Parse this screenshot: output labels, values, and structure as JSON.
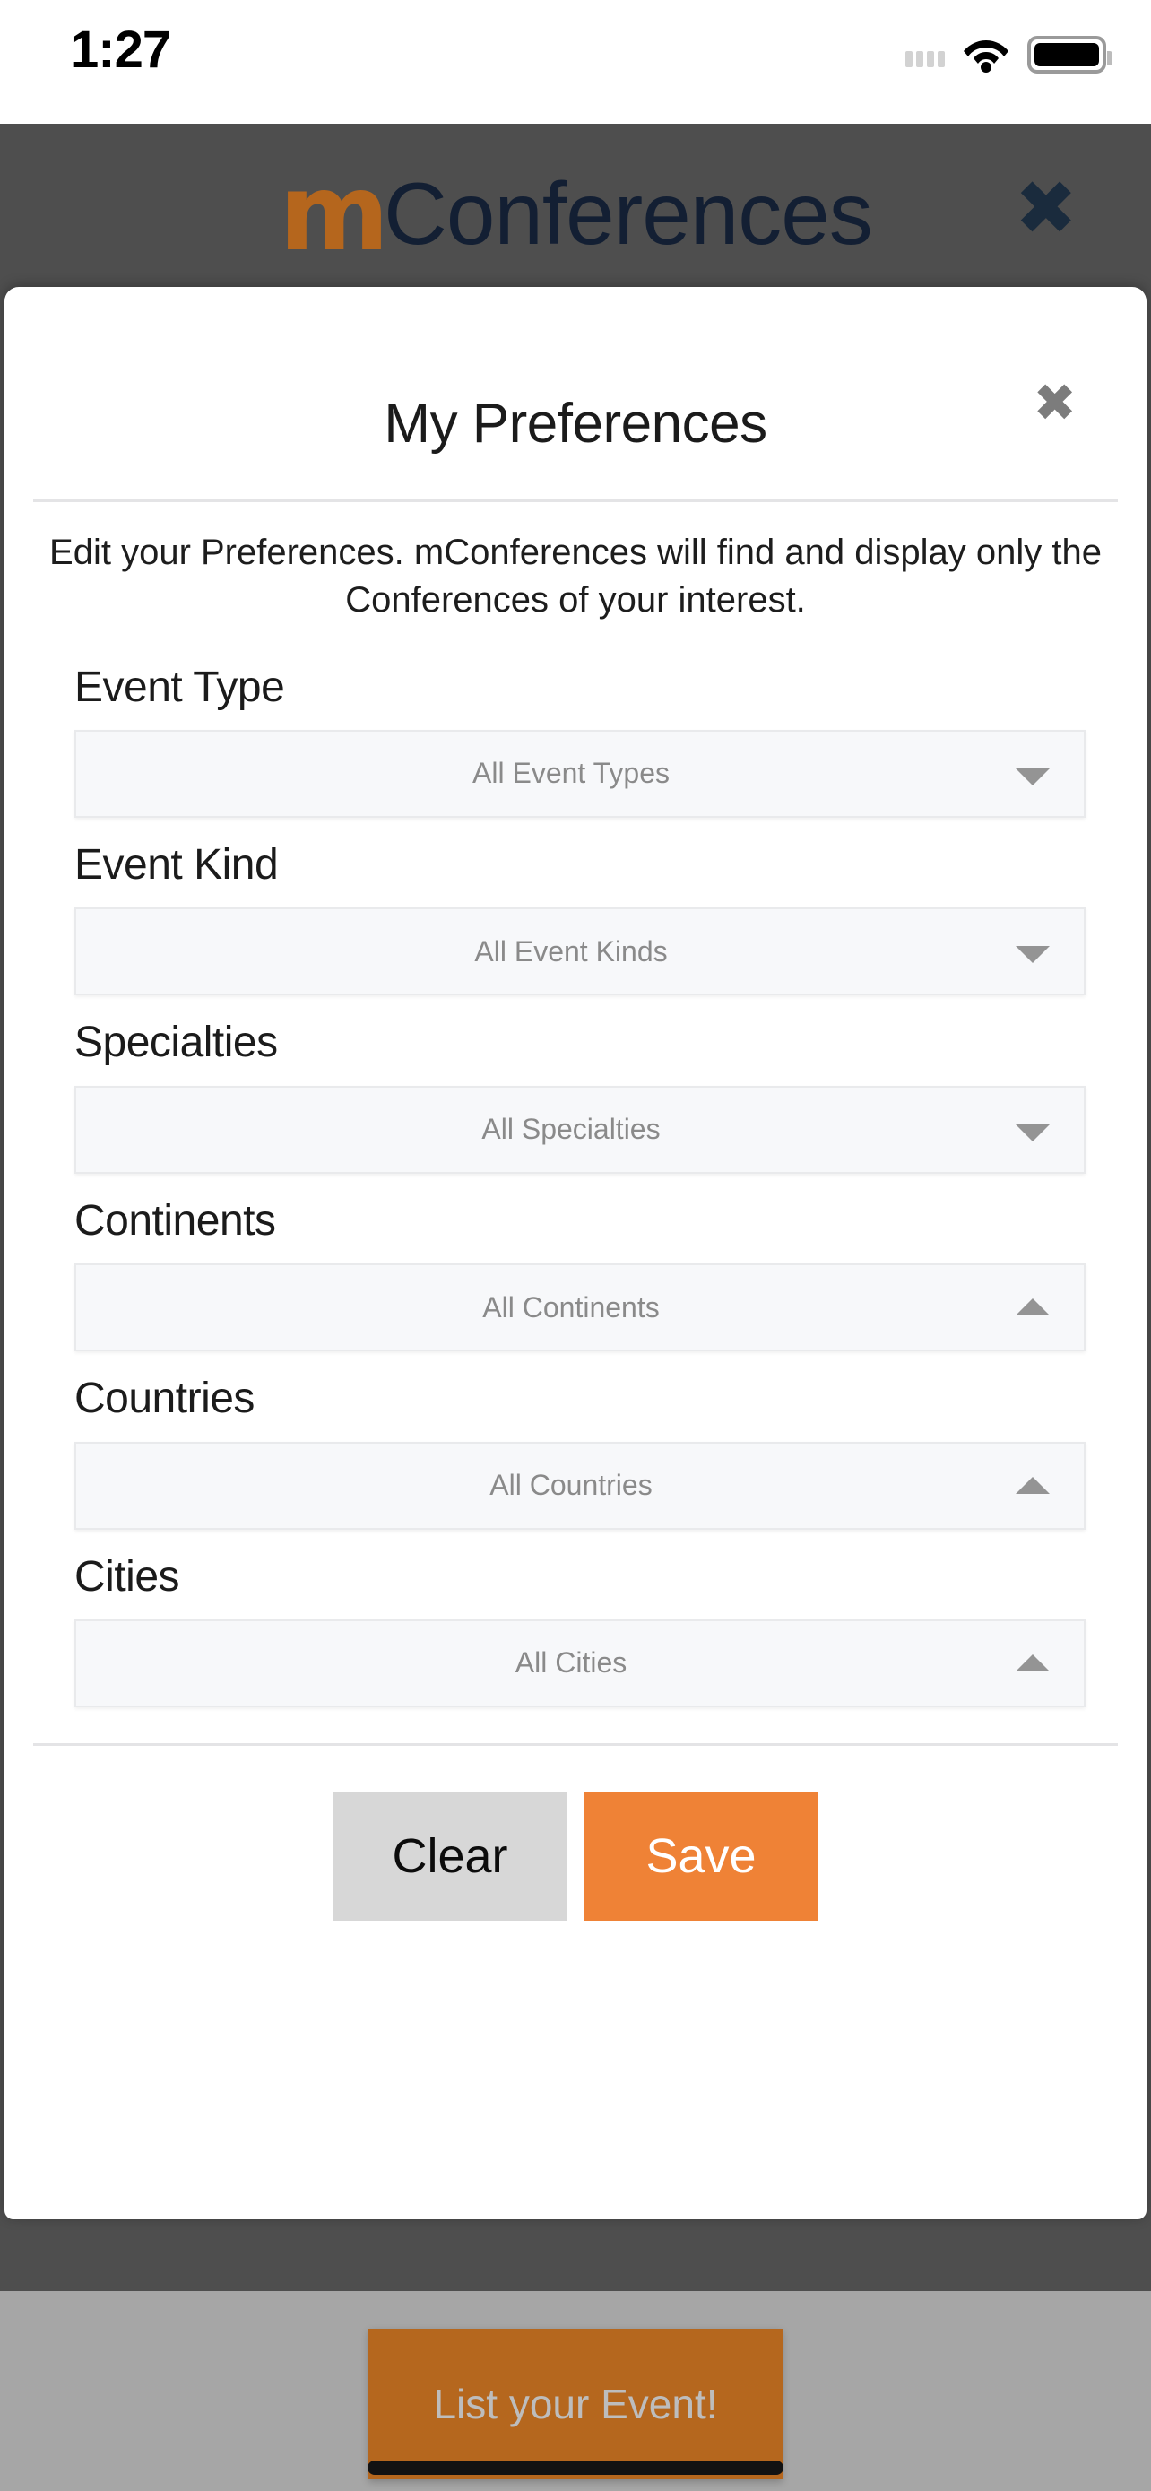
{
  "status_bar": {
    "time": "1:27",
    "signal_icon": "signal-dots-icon",
    "wifi_icon": "wifi-icon",
    "battery_icon": "battery-full-icon"
  },
  "app_header": {
    "brand_prefix": "m",
    "brand_name": "Conferences",
    "close_label": "✖",
    "brand_accent_color": "#b5661d",
    "brand_text_color": "#131f33",
    "background_color": "#4e4e4e"
  },
  "modal": {
    "title": "My Preferences",
    "close_label": "✖",
    "description": "Edit your Preferences. mConferences will find and display only the Conferences of your interest.",
    "fields": [
      {
        "label": "Event Type",
        "value": "All Event Types",
        "caret": "chevron-down-icon"
      },
      {
        "label": "Event Kind",
        "value": "All Event Kinds",
        "caret": "chevron-down-icon"
      },
      {
        "label": "Specialties",
        "value": "All Specialties",
        "caret": "chevron-down-icon"
      },
      {
        "label": "Continents",
        "value": "All Continents",
        "caret": "chevron-up-icon"
      },
      {
        "label": "Countries",
        "value": "All Countries",
        "caret": "chevron-up-icon"
      },
      {
        "label": "Cities",
        "value": "All Cities",
        "caret": "chevron-up-icon"
      }
    ],
    "actions": {
      "clear_label": "Clear",
      "save_label": "Save",
      "clear_color": "#d7d7d7",
      "save_color": "#ef8236"
    }
  },
  "bottom_bar": {
    "list_event_label": "List your Event!",
    "button_color": "#b5671e",
    "background_color": "#a6a6a6"
  }
}
